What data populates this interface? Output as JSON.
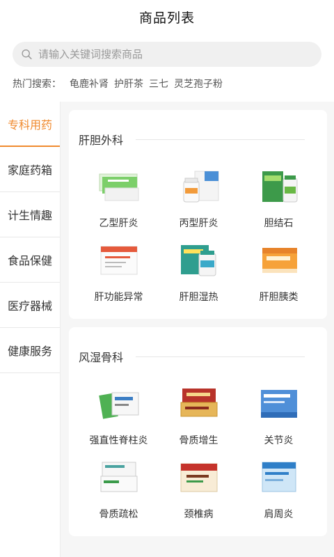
{
  "header": {
    "title": "商品列表"
  },
  "search": {
    "placeholder": "请输入关键词搜索商品"
  },
  "hot": {
    "label": "热门搜索：",
    "items": [
      "龟鹿补肾",
      "护肝茶",
      "三七",
      "灵芝孢子粉"
    ]
  },
  "sidebar": {
    "items": [
      {
        "label": "专科用药",
        "active": true
      },
      {
        "label": "家庭药箱"
      },
      {
        "label": "计生情趣"
      },
      {
        "label": "食品保健"
      },
      {
        "label": "医疗器械"
      },
      {
        "label": "健康服务"
      }
    ]
  },
  "sections": [
    {
      "title": "肝胆外科",
      "products": [
        {
          "name": "乙型肝炎",
          "icon": "green-medicine-box-icon"
        },
        {
          "name": "丙型肝炎",
          "icon": "white-bottle-box-icon"
        },
        {
          "name": "胆结石",
          "icon": "green-bottle-box-icon"
        },
        {
          "name": "肝功能异常",
          "icon": "red-white-box-icon"
        },
        {
          "name": "肝胆湿热",
          "icon": "teal-bottle-box-icon"
        },
        {
          "name": "肝胆胰类",
          "icon": "orange-box-icon"
        }
      ]
    },
    {
      "title": "风湿骨科",
      "products": [
        {
          "name": "强直性脊柱炎",
          "icon": "green-pack-icon"
        },
        {
          "name": "骨质增生",
          "icon": "red-gold-box-icon"
        },
        {
          "name": "关节炎",
          "icon": "blue-box-icon"
        },
        {
          "name": "骨质疏松",
          "icon": "white-green-box-icon"
        },
        {
          "name": "颈椎病",
          "icon": "red-cream-box-icon"
        },
        {
          "name": "肩周炎",
          "icon": "light-blue-box-icon"
        }
      ]
    }
  ],
  "colors": {
    "accent": "#f08a2e"
  }
}
